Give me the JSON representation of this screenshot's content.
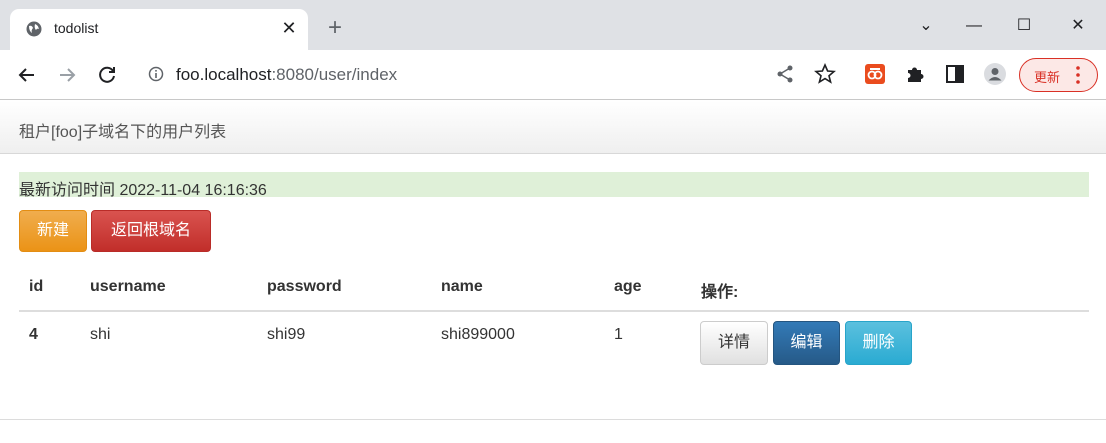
{
  "browser": {
    "tab_title": "todolist",
    "url_host": "foo.localhost",
    "url_rest": ":8080/user/index",
    "update_label": "更新"
  },
  "navbar": {
    "brand": "租户[foo]子域名下的用户列表"
  },
  "alert": {
    "text": "最新访问时间 2022-11-04 16:16:36"
  },
  "actions": {
    "new_label": "新建",
    "root_label": "返回根域名"
  },
  "table": {
    "headers": [
      "id",
      "username",
      "password",
      "name",
      "age",
      "操作:"
    ],
    "rows": [
      {
        "id": "4",
        "username": "shi",
        "password": "shi99",
        "name": "shi899000",
        "age": "1"
      }
    ],
    "row_actions": {
      "detail": "详情",
      "edit": "编辑",
      "delete": "删除"
    }
  },
  "colors": {
    "warning": "#f0ad4e",
    "danger": "#d9534f",
    "primary": "#337ab7",
    "info": "#5bc0de",
    "success_bg": "#dff0d8"
  }
}
